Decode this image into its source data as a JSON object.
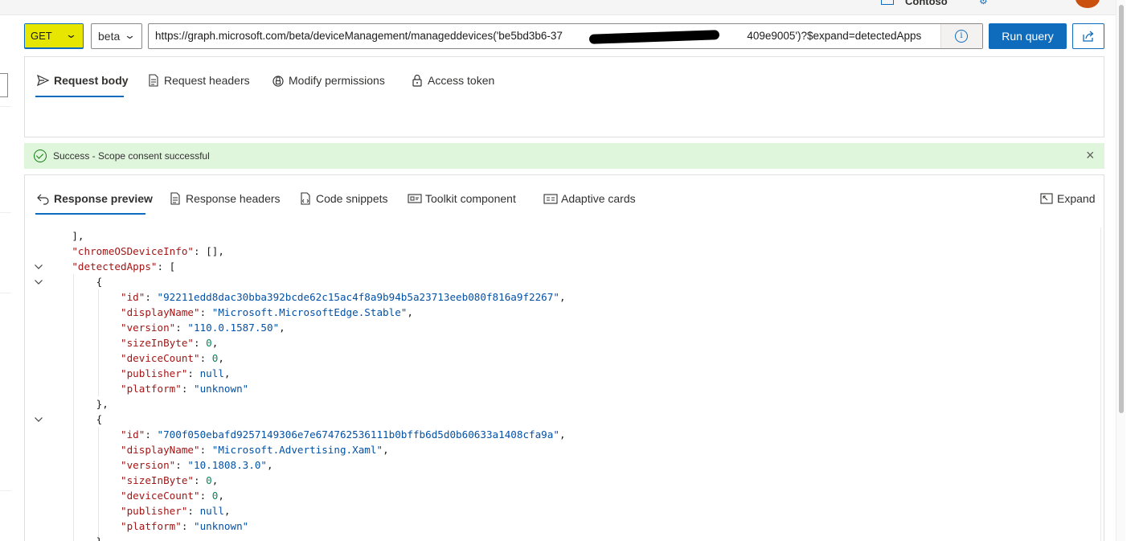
{
  "header": {
    "tenant": "Contoso"
  },
  "query": {
    "method": "GET",
    "version": "beta",
    "url": "https://graph.microsoft.com/beta/deviceManagement/manageddevices('be5bd3b6-37                 409e9005')?$expand=detectedApps",
    "run_label": "Run query"
  },
  "request_tabs": [
    {
      "label": "Request body",
      "icon": "send-icon",
      "active": true
    },
    {
      "label": "Request headers",
      "icon": "document-icon",
      "active": false
    },
    {
      "label": "Modify permissions",
      "icon": "lock-shield-icon",
      "active": false
    },
    {
      "label": "Access token",
      "icon": "lock-icon",
      "active": false
    }
  ],
  "banner": {
    "message": "Success - Scope consent successful",
    "status": "success",
    "color": "#dff6dd"
  },
  "response_tabs": [
    {
      "label": "Response preview",
      "icon": "undo-arrow-icon",
      "active": true
    },
    {
      "label": "Response headers",
      "icon": "document-icon",
      "active": false
    },
    {
      "label": "Code snippets",
      "icon": "code-file-icon",
      "active": false
    },
    {
      "label": "Toolkit component",
      "icon": "component-icon",
      "active": false
    },
    {
      "label": "Adaptive cards",
      "icon": "card-icon",
      "active": false
    }
  ],
  "expand_label": "Expand",
  "code_lines": [
    {
      "text": "    ],"
    },
    {
      "text": "    \"chromeOSDeviceInfo\": [],"
    },
    {
      "text": "    \"detectedApps\": [",
      "fold": true
    },
    {
      "text": "        {",
      "fold": true
    },
    {
      "text": "            \"id\": \"92211edd8dac30bba392bcde62c15ac4f8a9b94b5a23713eeb080f816a9f2267\","
    },
    {
      "text": "            \"displayName\": \"Microsoft.MicrosoftEdge.Stable\","
    },
    {
      "text": "            \"version\": \"110.0.1587.50\","
    },
    {
      "text": "            \"sizeInByte\": 0,"
    },
    {
      "text": "            \"deviceCount\": 0,"
    },
    {
      "text": "            \"publisher\": null,"
    },
    {
      "text": "            \"platform\": \"unknown\""
    },
    {
      "text": "        },"
    },
    {
      "text": "        {",
      "fold": true
    },
    {
      "text": "            \"id\": \"700f050ebafd9257149306e7e674762536111b0bffb6d5d0b60633a1408cfa9a\","
    },
    {
      "text": "            \"displayName\": \"Microsoft.Advertising.Xaml\","
    },
    {
      "text": "            \"version\": \"10.1808.3.0\","
    },
    {
      "text": "            \"sizeInByte\": 0,"
    },
    {
      "text": "            \"deviceCount\": 0,"
    },
    {
      "text": "            \"publisher\": null,"
    },
    {
      "text": "            \"platform\": \"unknown\""
    },
    {
      "text": "        },"
    }
  ],
  "colors": {
    "accent": "#0f6cbd",
    "method_highlight": "#e6e600",
    "json_key": "#a31515",
    "json_string": "#0451a5",
    "json_number": "#098658"
  }
}
